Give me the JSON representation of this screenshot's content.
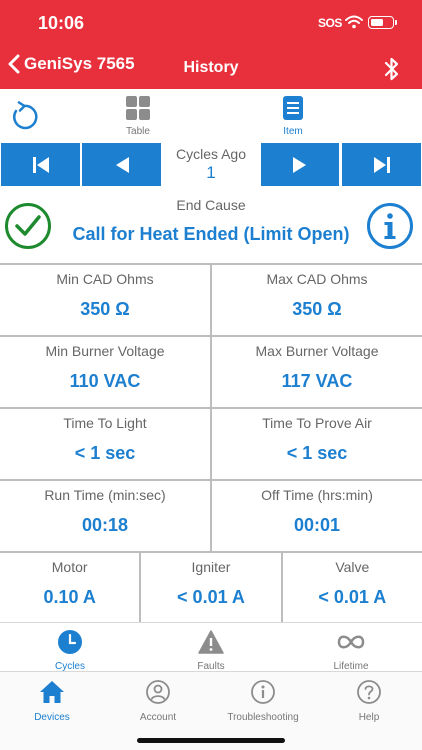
{
  "status_bar": {
    "time": "10:06",
    "sos": "SOS"
  },
  "header": {
    "back_label": "GeniSys 7565",
    "title": "History"
  },
  "views": [
    {
      "label": "Table",
      "active": false
    },
    {
      "label": "Item",
      "active": true
    }
  ],
  "pager": {
    "title": "Cycles Ago",
    "value": "1"
  },
  "end_cause": {
    "label": "End Cause",
    "value": "Call for Heat Ended (Limit Open)"
  },
  "readings": {
    "min_cad": {
      "label": "Min CAD Ohms",
      "value": "350 Ω"
    },
    "max_cad": {
      "label": "Max CAD Ohms",
      "value": "350 Ω"
    },
    "min_burner_voltage": {
      "label": "Min Burner Voltage",
      "value": "110 VAC"
    },
    "max_burner_voltage": {
      "label": "Max Burner Voltage",
      "value": "117 VAC"
    },
    "time_to_light": {
      "label": "Time To Light",
      "value": "< 1 sec"
    },
    "time_to_prove_air": {
      "label": "Time To Prove Air",
      "value": "< 1 sec"
    },
    "run_time": {
      "label": "Run Time (min:sec)",
      "value": "00:18"
    },
    "off_time": {
      "label": "Off Time (hrs:min)",
      "value": "00:01"
    },
    "motor": {
      "label": "Motor",
      "value": "0.10 A"
    },
    "igniter": {
      "label": "Igniter",
      "value": "< 0.01 A"
    },
    "valve": {
      "label": "Valve",
      "value": "< 0.01 A"
    }
  },
  "sub_tabs": [
    {
      "label": "Cycles",
      "icon": "clock-icon",
      "active": true
    },
    {
      "label": "Faults",
      "icon": "warning-icon",
      "active": false
    },
    {
      "label": "Lifetime",
      "icon": "infinity-icon",
      "active": false
    }
  ],
  "tab_bar": [
    {
      "label": "Devices",
      "icon": "home-icon",
      "active": true
    },
    {
      "label": "Account",
      "icon": "account-icon",
      "active": false
    },
    {
      "label": "Troubleshooting",
      "icon": "info-circle-icon",
      "active": false
    },
    {
      "label": "Help",
      "icon": "help-icon",
      "active": false
    }
  ],
  "colors": {
    "header_red": "#e8303c",
    "accent_blue": "#1c7fd0",
    "check_green": "#1e8a2e"
  }
}
